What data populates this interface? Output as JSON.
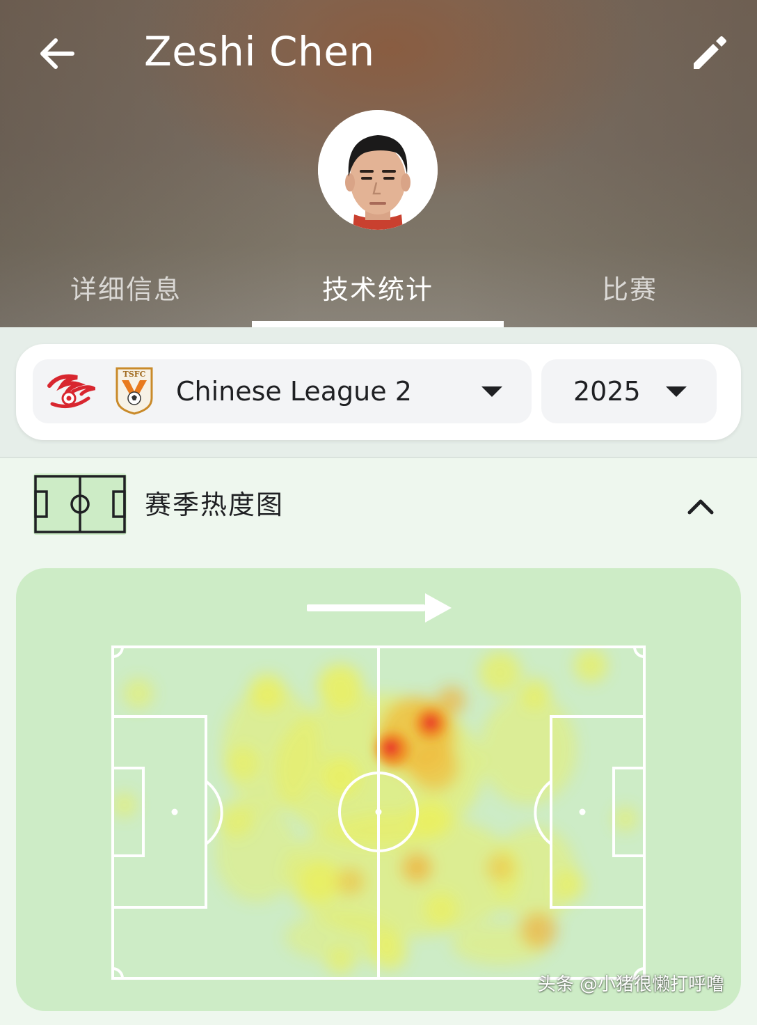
{
  "header": {
    "title": "Zeshi Chen",
    "back_icon": "arrow-left-icon",
    "edit_icon": "pencil-icon",
    "avatar": "player-avatar"
  },
  "tabs": [
    {
      "label": "详细信息",
      "active": false
    },
    {
      "label": "技术统计",
      "active": true
    },
    {
      "label": "比赛",
      "active": false
    }
  ],
  "filters": {
    "league_logo": "league-logo",
    "club_logo": "club-crest",
    "club_logo_text": "TSFC",
    "league_name": "Chinese League 2",
    "season": "2025"
  },
  "heatmap": {
    "title": "赛季热度图",
    "section_icon": "pitch-icon",
    "collapse_icon": "chevron-up-icon",
    "direction_icon": "arrow-right-icon",
    "intensity": {
      "hotspots_red": 2,
      "hotspots_orange": 4
    }
  },
  "watermark": "头条 @小猪很懒打呼噜",
  "colors": {
    "header_bg": "#7a6e62",
    "pitch_green": "#cdecc6",
    "section_bg": "#eef7ee",
    "heat_yellow": "#f3f23a",
    "heat_orange": "#f5a623",
    "heat_red": "#e8332b"
  }
}
